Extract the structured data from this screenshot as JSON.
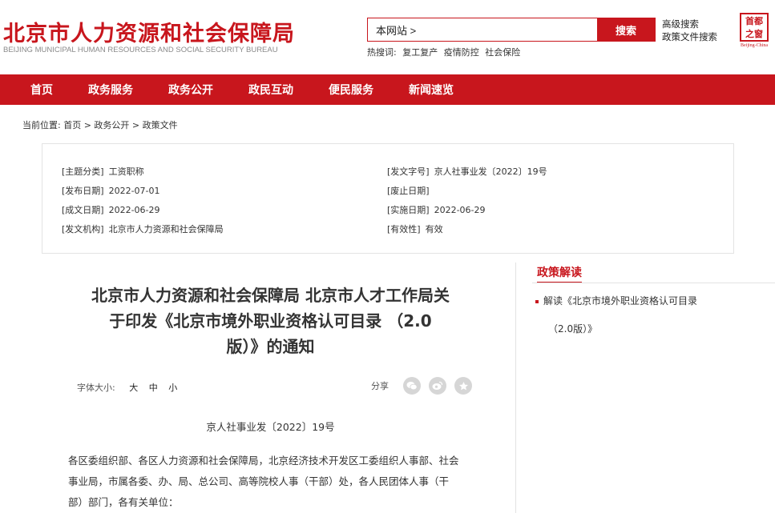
{
  "header": {
    "title": "北京市人力资源和社会保障局",
    "subtitle": "BEIJING MUNICIPAL HUMAN RESOURCES AND SOCIAL SECURITY BUREAU",
    "search_scope": "本网站 >",
    "search_button": "搜索",
    "advanced_search": "高级搜索",
    "policy_search": "政策文件搜索",
    "hot_label": "热搜词:",
    "hot_words": [
      "复工复产",
      "疫情防控",
      "社会保险"
    ],
    "seal_text": "首都之窗",
    "seal_en": "Beijing-China"
  },
  "nav": {
    "items": [
      "首页",
      "政务服务",
      "政务公开",
      "政民互动",
      "便民服务",
      "新闻速览"
    ]
  },
  "breadcrumb": "当前位置:  首页 > 政务公开 > 政策文件",
  "info": {
    "subject_k": "[主题分类]",
    "subject_v": "工资职称",
    "docno_k": "[发文字号]",
    "docno_v": "京人社事业发〔2022〕19号",
    "pubdate_k": "[发布日期]",
    "pubdate_v": "2022-07-01",
    "abolish_k": "[废止日期]",
    "abolish_v": "",
    "createdate_k": "[成文日期]",
    "createdate_v": "2022-06-29",
    "impldate_k": "[实施日期]",
    "impldate_v": "2022-06-29",
    "org_k": "[发文机构]",
    "org_v": "北京市人力资源和社会保障局",
    "valid_k": "[有效性]",
    "valid_v": "有效"
  },
  "article": {
    "title_lines": [
      "北京市人力资源和社会保障局 北京市人才工作局关",
      "于印发《北京市境外职业资格认可目录 （2.0",
      "版）》的通知"
    ],
    "font_label": "字体大小:",
    "font_large": "大",
    "font_medium": "中",
    "font_small": "小",
    "share_label": "分享",
    "doc_number": "京人社事业发〔2022〕19号",
    "body_lines": [
      "各区委组织部、各区人力资源和社会保障局，北京经济技术开发区工委组织人事部、社会",
      "事业局，市属各委、办、局、总公司、高等院校人事（干部）处，各人民团体人事（干",
      "部）部门，各有关单位："
    ]
  },
  "sidebar": {
    "title": "政策解读",
    "link_lines": [
      "解读《北京市境外职业资格认可目录",
      "（2.0版）》"
    ]
  }
}
